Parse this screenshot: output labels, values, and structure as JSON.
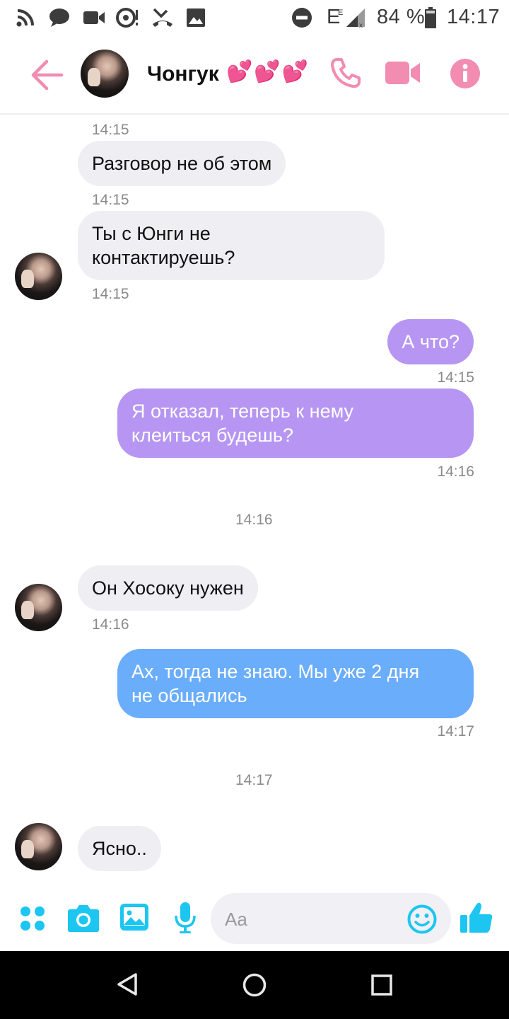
{
  "status_bar": {
    "battery_percent": "84 %",
    "clock": "14:17",
    "network": "E",
    "icons": [
      "rss-icon",
      "chat-icon",
      "video-icon",
      "sync-icon",
      "missed-call-icon",
      "image-icon",
      "dnd-icon",
      "signal-icon",
      "battery-icon"
    ]
  },
  "header": {
    "contact_name": "Чонгук",
    "name_emoji": "💕💕💕",
    "icons": [
      "back-arrow-icon",
      "phone-icon",
      "video-camera-icon",
      "info-icon"
    ],
    "accent_color": "#f28cb0"
  },
  "messages": [
    {
      "kind": "time",
      "text": "14:15"
    },
    {
      "kind": "in",
      "text": "Разговор не об этом",
      "time": "14:15"
    },
    {
      "kind": "in",
      "lines": [
        "Ты с Юнги не",
        "контактируешь?"
      ],
      "time": "14:15"
    },
    {
      "kind": "out",
      "text": "А что?",
      "time": "14:15",
      "color": "#b696f2"
    },
    {
      "kind": "out",
      "lines": [
        "Я отказал, теперь к нему",
        "клеиться будешь?"
      ],
      "time": "14:16",
      "color": "#b696f2"
    },
    {
      "kind": "divider",
      "text": "14:16"
    },
    {
      "kind": "in",
      "text": "Он Хосоку нужен",
      "time": "14:16"
    },
    {
      "kind": "out",
      "lines": [
        "Ах, тогда не знаю. Мы уже 2 дня",
        "не общались"
      ],
      "time": "14:17",
      "color": "#6aadfb"
    },
    {
      "kind": "divider",
      "text": "14:17"
    },
    {
      "kind": "in",
      "text": "Ясно.."
    }
  ],
  "composer": {
    "placeholder": "Aa",
    "icons": [
      "apps-icon",
      "camera-icon",
      "gallery-icon",
      "microphone-icon",
      "emoji-icon",
      "thumbs-up-icon"
    ],
    "accent_color": "#1cc6f0"
  },
  "nav_bar": {
    "icons": [
      "back-triangle-icon",
      "home-circle-icon",
      "recents-square-icon"
    ]
  }
}
